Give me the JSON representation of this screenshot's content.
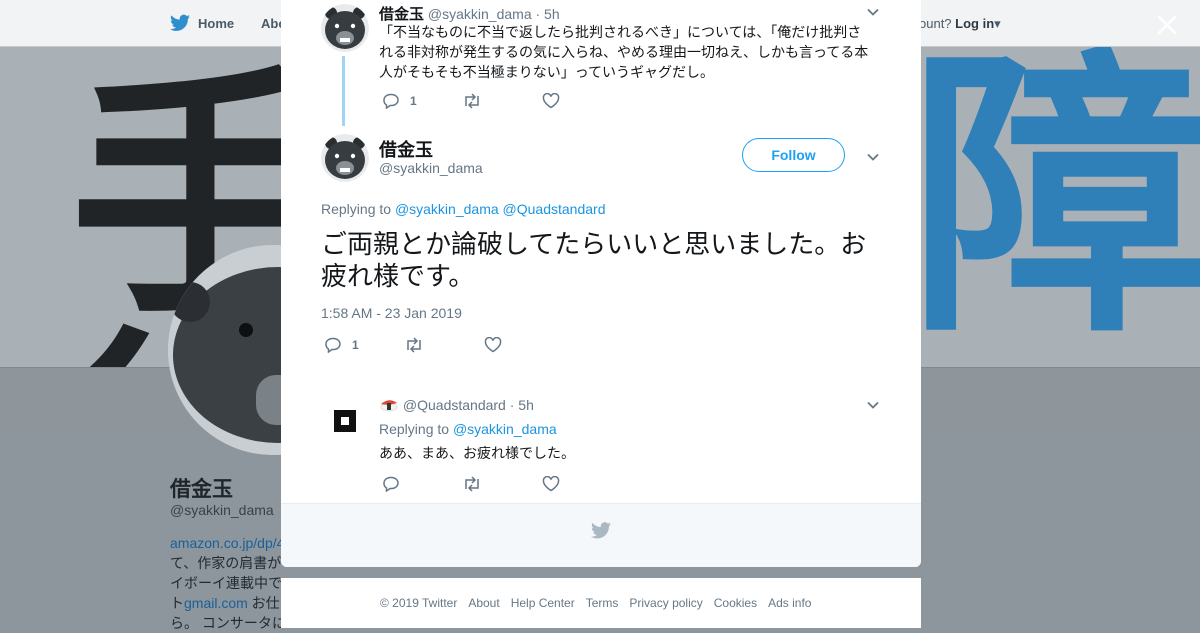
{
  "nav": {
    "home": "Home",
    "about": "Abo",
    "account": "ccount?",
    "login": "Log in"
  },
  "profile": {
    "name": "借金玉",
    "handle": "@syakkin_dama",
    "bio_link1": "amazon.co.jp/dp/4",
    "bio_line2": "て、作家の肩書が",
    "bio_line3": "イボーイ連載中で",
    "bio_line4_pre": "ト",
    "bio_link2": "gmail.com",
    "bio_line4_post": " お仕",
    "bio_line5": "ら。 コンサータに"
  },
  "tweet1": {
    "name": "借金玉",
    "handle": "@syakkin_dama",
    "time": "· 5h",
    "text": "「不当なものに不当で返したら批判されるべき」については、「俺だけ批判される非対称が発生するの気に入らね、やめる理由一切ねえ、しかも言ってる本人がそもそも不当極まりない」っていうギャグだし。",
    "replies": "1"
  },
  "main_tweet": {
    "name": "借金玉",
    "handle": "@syakkin_dama",
    "follow": "Follow",
    "replying_to": "Replying to",
    "mention1": "@syakkin_dama",
    "mention2": "@Quadstandard",
    "text": "ご両親とか論破してたらいいと思いました。お疲れ様です。",
    "timestamp": "1:58 AM - 23 Jan 2019",
    "replies": "1"
  },
  "reply": {
    "handle": "@Quadstandard",
    "time": "· 5h",
    "replying_to": "Replying to",
    "mention": "@syakkin_dama",
    "text": "ああ、まあ、お疲れ様でした。"
  },
  "footer": {
    "copyright": "© 2019 Twitter",
    "about": "About",
    "help": "Help Center",
    "terms": "Terms",
    "privacy": "Privacy policy",
    "cookies": "Cookies",
    "ads": "Ads info"
  },
  "colors": {
    "twitter_blue": "#1da1f2",
    "link_blue": "#1b95e0",
    "thread_line": "#9ed5f7"
  }
}
